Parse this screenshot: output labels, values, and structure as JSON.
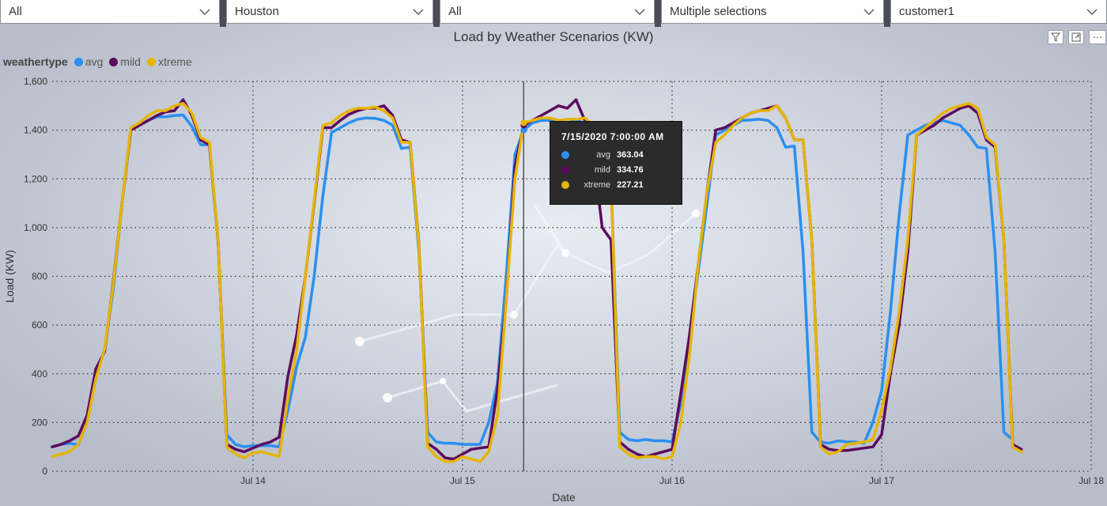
{
  "filters": [
    {
      "value": "All"
    },
    {
      "value": "Houston"
    },
    {
      "value": "All"
    },
    {
      "value": "Multiple selections"
    },
    {
      "value": "customer1"
    }
  ],
  "chart_data": {
    "type": "line",
    "title": "Load by Weather Scenarios (KW)",
    "xlabel": "Date",
    "ylabel": "Load (KW)",
    "ylim": [
      0,
      1600
    ],
    "yticks": [
      "0",
      "200",
      "400",
      "600",
      "800",
      "1,000",
      "1,200",
      "1,400",
      "1,600"
    ],
    "xticks": [
      {
        "label": "Jul 14",
        "value": "2020-07-14"
      },
      {
        "label": "Jul 15",
        "value": "2020-07-15"
      },
      {
        "label": "Jul 16",
        "value": "2020-07-16"
      },
      {
        "label": "Jul 17",
        "value": "2020-07-17"
      },
      {
        "label": "Jul 18",
        "value": "2020-07-18"
      }
    ],
    "xrange": [
      "2020-07-13 01:00",
      "2020-07-18 00:00"
    ],
    "legend_title": "weathertype",
    "legend_position": "top-left",
    "grid": true,
    "x": [
      "2020-07-13 01:00",
      "2020-07-13 02:00",
      "2020-07-13 03:00",
      "2020-07-13 04:00",
      "2020-07-13 05:00",
      "2020-07-13 06:00",
      "2020-07-13 07:00",
      "2020-07-13 08:00",
      "2020-07-13 09:00",
      "2020-07-13 10:00",
      "2020-07-13 11:00",
      "2020-07-13 12:00",
      "2020-07-13 13:00",
      "2020-07-13 14:00",
      "2020-07-13 15:00",
      "2020-07-13 16:00",
      "2020-07-13 17:00",
      "2020-07-13 18:00",
      "2020-07-13 19:00",
      "2020-07-13 20:00",
      "2020-07-13 21:00",
      "2020-07-13 22:00",
      "2020-07-13 23:00",
      "2020-07-14 00:00",
      "2020-07-14 01:00",
      "2020-07-14 02:00",
      "2020-07-14 03:00",
      "2020-07-14 04:00",
      "2020-07-14 05:00",
      "2020-07-14 06:00",
      "2020-07-14 07:00",
      "2020-07-14 08:00",
      "2020-07-14 09:00",
      "2020-07-14 10:00",
      "2020-07-14 11:00",
      "2020-07-14 12:00",
      "2020-07-14 13:00",
      "2020-07-14 14:00",
      "2020-07-14 15:00",
      "2020-07-14 16:00",
      "2020-07-14 17:00",
      "2020-07-14 18:00",
      "2020-07-14 19:00",
      "2020-07-14 20:00",
      "2020-07-14 21:00",
      "2020-07-14 22:00",
      "2020-07-14 23:00",
      "2020-07-15 00:00",
      "2020-07-15 01:00",
      "2020-07-15 02:00",
      "2020-07-15 03:00",
      "2020-07-15 04:00",
      "2020-07-15 05:00",
      "2020-07-15 06:00",
      "2020-07-15 07:00",
      "2020-07-15 08:00",
      "2020-07-15 09:00",
      "2020-07-15 10:00",
      "2020-07-15 11:00",
      "2020-07-15 12:00",
      "2020-07-15 13:00",
      "2020-07-15 14:00",
      "2020-07-15 15:00",
      "2020-07-15 16:00",
      "2020-07-15 17:00",
      "2020-07-15 18:00",
      "2020-07-15 19:00",
      "2020-07-15 20:00",
      "2020-07-15 21:00",
      "2020-07-15 22:00",
      "2020-07-15 23:00",
      "2020-07-16 00:00",
      "2020-07-16 01:00",
      "2020-07-16 02:00",
      "2020-07-16 03:00",
      "2020-07-16 04:00",
      "2020-07-16 05:00",
      "2020-07-16 06:00",
      "2020-07-16 07:00",
      "2020-07-16 08:00",
      "2020-07-16 09:00",
      "2020-07-16 10:00",
      "2020-07-16 11:00",
      "2020-07-16 12:00",
      "2020-07-16 13:00",
      "2020-07-16 14:00",
      "2020-07-16 15:00",
      "2020-07-16 16:00",
      "2020-07-16 17:00",
      "2020-07-16 18:00",
      "2020-07-16 19:00",
      "2020-07-16 20:00",
      "2020-07-16 21:00",
      "2020-07-16 22:00",
      "2020-07-16 23:00",
      "2020-07-17 00:00",
      "2020-07-17 01:00",
      "2020-07-17 02:00",
      "2020-07-17 03:00",
      "2020-07-17 04:00",
      "2020-07-17 05:00",
      "2020-07-17 06:00",
      "2020-07-17 07:00",
      "2020-07-17 08:00",
      "2020-07-17 09:00",
      "2020-07-17 10:00",
      "2020-07-17 11:00",
      "2020-07-17 12:00",
      "2020-07-17 13:00",
      "2020-07-17 14:00",
      "2020-07-17 15:00",
      "2020-07-17 16:00",
      "2020-07-17 17:00",
      "2020-07-17 18:00",
      "2020-07-17 19:00",
      "2020-07-17 20:00",
      "2020-07-17 21:00",
      "2020-07-17 22:00",
      "2020-07-17 23:00",
      "2020-07-18 00:00"
    ],
    "series": [
      {
        "name": "avg",
        "color": "#2a8ff0",
        "values": [
          100,
          110,
          115,
          108,
          200,
          390,
          500,
          750,
          1100,
          1400,
          1420,
          1440,
          1455,
          1455,
          1460,
          1462,
          1415,
          1340,
          1340,
          940,
          150,
          110,
          100,
          105,
          105,
          105,
          100,
          250,
          430,
          550,
          800,
          1130,
          1390,
          1410,
          1430,
          1445,
          1450,
          1448,
          1440,
          1420,
          1325,
          1330,
          900,
          160,
          120,
          115,
          115,
          110,
          110,
          110,
          200,
          363,
          800,
          1300,
          1400,
          1430,
          1440,
          1440,
          1440,
          1430,
          1440,
          1430,
          1420,
          1410,
          1200,
          160,
          130,
          125,
          130,
          125,
          125,
          120,
          280,
          560,
          820,
          1100,
          1380,
          1400,
          1420,
          1440,
          1442,
          1445,
          1440,
          1410,
          1330,
          1335,
          900,
          160,
          120,
          115,
          125,
          120,
          120,
          115,
          200,
          330,
          650,
          1050,
          1380,
          1400,
          1420,
          1430,
          1440,
          1430,
          1420,
          1380,
          1330,
          1325,
          900,
          160,
          130
        ]
      },
      {
        "name": "mild",
        "color": "#5c0a5e",
        "values": [
          100,
          110,
          125,
          145,
          230,
          420,
          490,
          780,
          1100,
          1400,
          1420,
          1440,
          1460,
          1475,
          1480,
          1525,
          1460,
          1360,
          1340,
          950,
          110,
          90,
          80,
          95,
          110,
          120,
          140,
          390,
          560,
          800,
          1100,
          1410,
          1410,
          1440,
          1465,
          1480,
          1490,
          1490,
          1500,
          1460,
          1360,
          1350,
          930,
          115,
          90,
          55,
          50,
          70,
          90,
          95,
          100,
          335,
          700,
          1250,
          1420,
          1440,
          1460,
          1480,
          1500,
          1490,
          1525,
          1440,
          1300,
          1000,
          950,
          120,
          90,
          70,
          60,
          70,
          80,
          90,
          320,
          560,
          850,
          1150,
          1400,
          1410,
          1430,
          1450,
          1470,
          1480,
          1490,
          1500,
          1450,
          1360,
          1360,
          950,
          110,
          90,
          85,
          85,
          90,
          95,
          100,
          150,
          400,
          600,
          900,
          1380,
          1400,
          1420,
          1450,
          1470,
          1490,
          1500,
          1470,
          1360,
          1330,
          950,
          110,
          90
        ]
      },
      {
        "name": "xtreme",
        "color": "#e6b400",
        "values": [
          60,
          70,
          80,
          110,
          200,
          380,
          500,
          770,
          1100,
          1410,
          1430,
          1460,
          1480,
          1480,
          1500,
          1510,
          1470,
          1370,
          1350,
          950,
          100,
          70,
          55,
          75,
          80,
          70,
          60,
          300,
          500,
          800,
          1110,
          1420,
          1430,
          1460,
          1480,
          1490,
          1490,
          1495,
          1480,
          1450,
          1350,
          1350,
          920,
          100,
          60,
          40,
          40,
          60,
          50,
          40,
          80,
          227,
          700,
          1200,
          1430,
          1440,
          1450,
          1450,
          1440,
          1445,
          1445,
          1450,
          1420,
          1410,
          1200,
          100,
          70,
          55,
          60,
          60,
          50,
          60,
          200,
          480,
          850,
          1150,
          1350,
          1380,
          1420,
          1450,
          1470,
          1480,
          1480,
          1500,
          1450,
          1360,
          1360,
          950,
          100,
          70,
          80,
          110,
          115,
          120,
          130,
          250,
          420,
          650,
          950,
          1380,
          1410,
          1440,
          1470,
          1490,
          1500,
          1510,
          1490,
          1370,
          1340,
          950,
          100,
          80
        ]
      }
    ],
    "hover_x": "2020-07-15 07:00",
    "tooltip": {
      "title": "7/15/2020 7:00:00 AM",
      "rows": [
        {
          "name": "avg",
          "value": "363.04"
        },
        {
          "name": "mild",
          "value": "334.76"
        },
        {
          "name": "xtreme",
          "value": "227.21"
        }
      ]
    }
  }
}
